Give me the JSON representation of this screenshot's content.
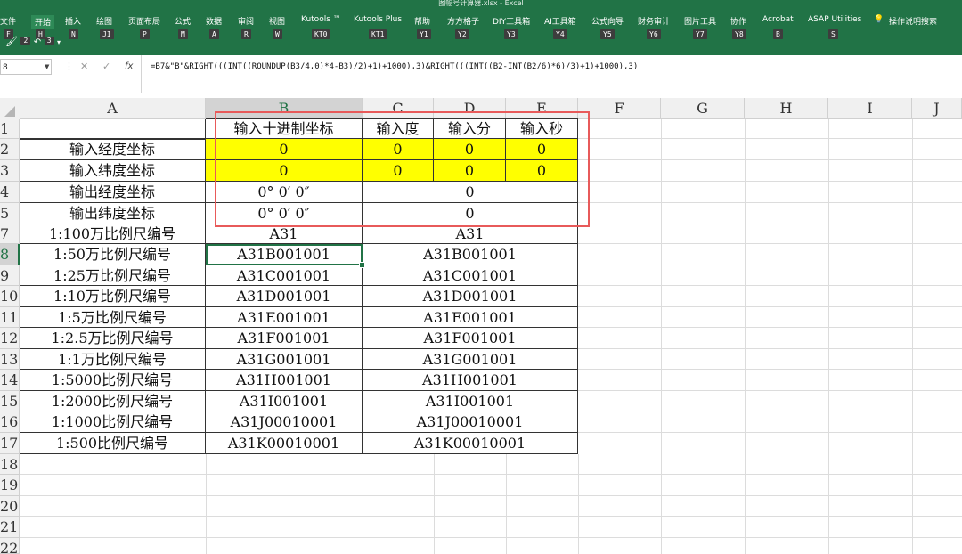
{
  "window_title": "图幅号计算器.xlsx  -  Excel",
  "ribbon": {
    "tabs": [
      {
        "label": "文件",
        "key": "F",
        "active": false
      },
      {
        "label": "开始",
        "key": "H",
        "active": true
      },
      {
        "label": "插入",
        "key": "N",
        "active": false
      },
      {
        "label": "绘图",
        "key": "JI",
        "active": false
      },
      {
        "label": "页面布局",
        "key": "P",
        "active": false
      },
      {
        "label": "公式",
        "key": "M",
        "active": false
      },
      {
        "label": "数据",
        "key": "A",
        "active": false
      },
      {
        "label": "审阅",
        "key": "R",
        "active": false
      },
      {
        "label": "视图",
        "key": "W",
        "active": false
      },
      {
        "label": "Kutools ™",
        "key": "KT0",
        "active": false
      },
      {
        "label": "Kutools Plus",
        "key": "KT1",
        "active": false
      },
      {
        "label": "帮助",
        "key": "Y1",
        "active": false
      },
      {
        "label": "方方格子",
        "key": "Y2",
        "active": false
      },
      {
        "label": "DIY工具箱",
        "key": "Y3",
        "active": false
      },
      {
        "label": "AI工具箱",
        "key": "Y4",
        "active": false
      },
      {
        "label": "公式向导",
        "key": "Y5",
        "active": false
      },
      {
        "label": "财务审计",
        "key": "Y6",
        "active": false
      },
      {
        "label": "图片工具",
        "key": "Y7",
        "active": false
      },
      {
        "label": "协作",
        "key": "Y8",
        "active": false
      },
      {
        "label": "Acrobat",
        "key": "B",
        "active": false
      },
      {
        "label": "ASAP Utilities",
        "key": "S",
        "active": false
      }
    ],
    "tell_me": "操作说明搜索",
    "qat_keys": [
      "2",
      "3"
    ]
  },
  "formula_bar": {
    "name_box": "8",
    "formula": "=B7&\"B\"&RIGHT(((INT((ROUNDUP(B3/4,0)*4-B3)/2)+1)+1000),3)&RIGHT(((INT((B2-INT(B2/6)*6)/3)+1)+1000),3)"
  },
  "columns": [
    "A",
    "B",
    "C",
    "D",
    "E",
    "F",
    "G",
    "H",
    "I",
    "J"
  ],
  "rows": [
    "1",
    "2",
    "3",
    "4",
    "5",
    "7",
    "8",
    "9",
    "10",
    "11",
    "12",
    "13",
    "14",
    "15",
    "16",
    "17",
    "18",
    "19",
    "20",
    "21",
    "22"
  ],
  "cells": {
    "r1": {
      "b": "输入十进制坐标",
      "c": "输入度",
      "d": "输入分",
      "e": "输入秒"
    },
    "r2": {
      "a": "输入经度坐标",
      "b": "0",
      "c": "0",
      "d": "0",
      "e": "0"
    },
    "r3": {
      "a": "输入纬度坐标",
      "b": "0",
      "c": "0",
      "d": "0",
      "e": "0"
    },
    "r4": {
      "a": "输出经度坐标",
      "b": "0° 0′ 0″",
      "c": "0"
    },
    "r5": {
      "a": "输出纬度坐标",
      "b": "0° 0′ 0″",
      "c": "0"
    },
    "r7": {
      "a": "1:100万比例尺编号",
      "b": "A31",
      "c": "A31"
    },
    "r8": {
      "a": "1:50万比例尺编号",
      "b": "A31B001001",
      "c": "A31B001001"
    },
    "r9": {
      "a": "1:25万比例尺编号",
      "b": "A31C001001",
      "c": "A31C001001"
    },
    "r10": {
      "a": "1:10万比例尺编号",
      "b": "A31D001001",
      "c": "A31D001001"
    },
    "r11": {
      "a": "1:5万比例尺编号",
      "b": "A31E001001",
      "c": "A31E001001"
    },
    "r12": {
      "a": "1:2.5万比例尺编号",
      "b": "A31F001001",
      "c": "A31F001001"
    },
    "r13": {
      "a": "1:1万比例尺编号",
      "b": "A31G001001",
      "c": "A31G001001"
    },
    "r14": {
      "a": "1:5000比例尺编号",
      "b": "A31H001001",
      "c": "A31H001001"
    },
    "r15": {
      "a": "1:2000比例尺编号",
      "b": "A31I001001",
      "c": "A31I001001"
    },
    "r16": {
      "a": "1:1000比例尺编号",
      "b": "A31J00010001",
      "c": "A31J00010001"
    },
    "r17": {
      "a": "1:500比例尺编号",
      "b": "A31K00010001",
      "c": "A31K00010001"
    }
  },
  "colors": {
    "ribbon": "#217346",
    "input_fill": "#ffff00",
    "highlight_box": "#e85a5a",
    "selection": "#217346"
  }
}
